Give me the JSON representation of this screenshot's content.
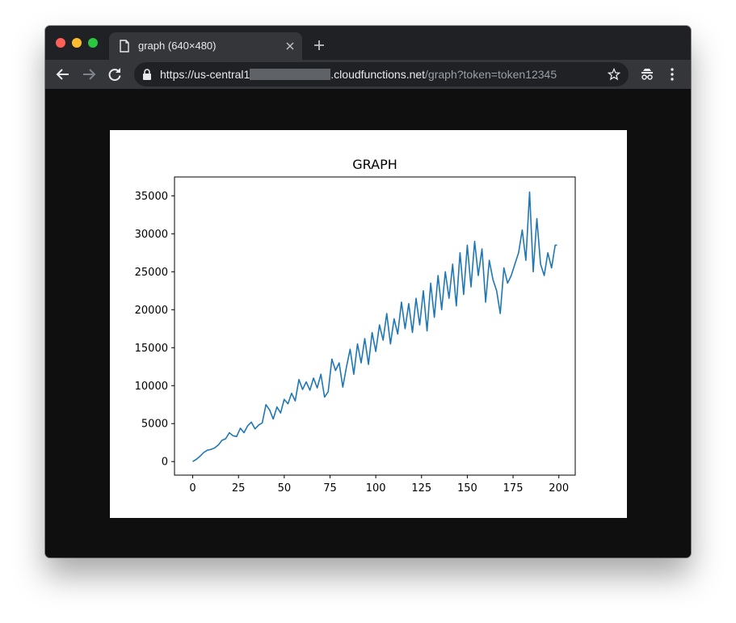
{
  "browser": {
    "tab_title": "graph (640×480)",
    "url": {
      "scheme": "https://",
      "host_prefix": "us-central1",
      "host_suffix": ".cloudfunctions.net",
      "path": "/graph?token=token12345"
    },
    "icons": {
      "tab": "document-icon",
      "close": "close-icon",
      "new_tab": "plus-icon",
      "back": "back-arrow-icon",
      "forward": "forward-arrow-icon",
      "reload": "reload-icon",
      "secure": "lock-icon",
      "bookmark": "star-icon",
      "incognito": "incognito-icon",
      "menu": "kebab-menu-icon"
    }
  },
  "chart_data": {
    "type": "line",
    "title": "GRAPH",
    "xlabel": "",
    "ylabel": "",
    "xlim": [
      -9.95,
      208.95
    ],
    "ylim": [
      -1785,
      37485
    ],
    "xticks": [
      0,
      25,
      50,
      75,
      100,
      125,
      150,
      175,
      200
    ],
    "yticks": [
      0,
      5000,
      10000,
      15000,
      20000,
      25000,
      30000,
      35000
    ],
    "grid": false,
    "legend": "none",
    "series": [
      {
        "color": "#1f77b4",
        "x": [
          0,
          2,
          4,
          6,
          8,
          10,
          12,
          14,
          16,
          18,
          20,
          22,
          24,
          26,
          28,
          30,
          32,
          34,
          36,
          38,
          40,
          42,
          44,
          46,
          48,
          50,
          52,
          54,
          56,
          58,
          60,
          62,
          64,
          66,
          68,
          70,
          72,
          74,
          76,
          78,
          80,
          82,
          84,
          86,
          88,
          90,
          92,
          94,
          96,
          98,
          100,
          102,
          104,
          106,
          108,
          110,
          112,
          114,
          116,
          118,
          120,
          122,
          124,
          126,
          128,
          130,
          132,
          134,
          136,
          138,
          140,
          142,
          144,
          146,
          148,
          150,
          152,
          154,
          156,
          158,
          160,
          162,
          164,
          166,
          168,
          170,
          172,
          174,
          176,
          178,
          180,
          182,
          184,
          186,
          188,
          190,
          192,
          194,
          196,
          198,
          199
        ],
        "y": [
          0,
          300,
          700,
          1200,
          1500,
          1600,
          1800,
          2200,
          2800,
          3000,
          3800,
          3400,
          3300,
          4400,
          3800,
          4700,
          5200,
          4300,
          4800,
          5100,
          7500,
          6800,
          5600,
          7200,
          6400,
          8200,
          7600,
          9000,
          8000,
          10800,
          9500,
          10500,
          9400,
          11000,
          9700,
          11500,
          8500,
          9200,
          13500,
          12000,
          13000,
          9800,
          12500,
          14800,
          11500,
          15500,
          13000,
          16200,
          12800,
          17000,
          14500,
          18000,
          16000,
          19500,
          15500,
          18800,
          16800,
          21000,
          17500,
          20800,
          17000,
          21500,
          18000,
          22500,
          17200,
          23500,
          19000,
          24500,
          20000,
          25000,
          21500,
          26000,
          20500,
          27500,
          22000,
          28500,
          23000,
          29000,
          24500,
          28000,
          21000,
          26500,
          24000,
          22500,
          19500,
          25500,
          23500,
          24500,
          26000,
          27500,
          30500,
          26500,
          35500,
          25000,
          32000,
          26000,
          24500,
          27500,
          25500,
          28500,
          28500
        ],
        "note_y_estimated_from_gridlines": true
      }
    ]
  }
}
